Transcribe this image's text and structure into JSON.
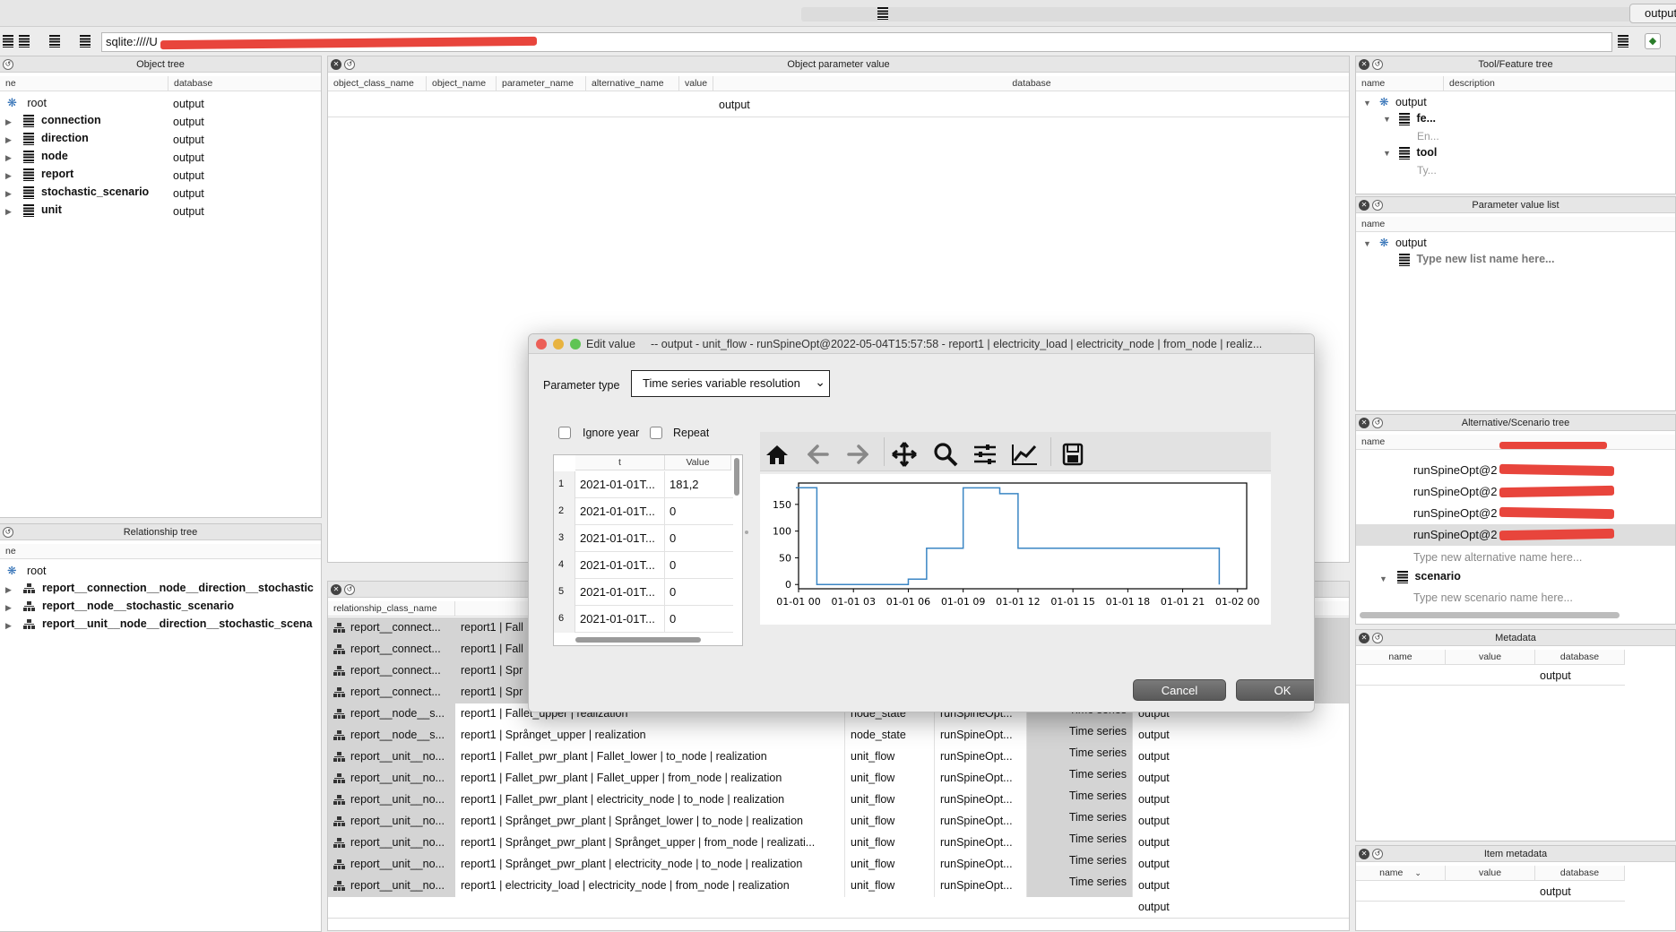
{
  "topbar": {
    "output_tab": "output",
    "url": "sqlite:////U"
  },
  "object_tree": {
    "title": "Object tree",
    "col_name": "ne",
    "col_db": "database",
    "root": {
      "label": "root",
      "db": "output"
    },
    "items": [
      {
        "label": "connection",
        "db": "output"
      },
      {
        "label": "direction",
        "db": "output"
      },
      {
        "label": "node",
        "db": "output"
      },
      {
        "label": "report",
        "db": "output"
      },
      {
        "label": "stochastic_scenario",
        "db": "output"
      },
      {
        "label": "unit",
        "db": "output"
      }
    ]
  },
  "relationship_tree": {
    "title": "Relationship tree",
    "col_name": "ne",
    "root": "root",
    "items": [
      "report__connection__node__direction__stochastic",
      "report__node__stochastic_scenario",
      "report__unit__node__direction__stochastic_scena"
    ]
  },
  "object_parameter_value": {
    "title": "Object parameter value",
    "headers": [
      "object_class_name",
      "object_name",
      "parameter_name",
      "alternative_name",
      "value",
      "database"
    ],
    "row_db": "output"
  },
  "relationship_parameter_value": {
    "header": "relationship_class_name",
    "rows": [
      {
        "cls": "report__connect...",
        "obj": "report1 | Fall",
        "param": "",
        "alt": "",
        "val": "",
        "db": ""
      },
      {
        "cls": "report__connect...",
        "obj": "report1 | Fall",
        "param": "",
        "alt": "",
        "val": "",
        "db": ""
      },
      {
        "cls": "report__connect...",
        "obj": "report1 | Spr",
        "param": "",
        "alt": "",
        "val": "",
        "db": ""
      },
      {
        "cls": "report__connect...",
        "obj": "report1 | Spr",
        "param": "",
        "alt": "",
        "val": "",
        "db": ""
      },
      {
        "cls": "report__node__s...",
        "obj": "report1 | Fallet_upper | realization",
        "param": "node_state",
        "alt": "runSpineOpt...",
        "val": "Time series",
        "db": "output"
      },
      {
        "cls": "report__node__s...",
        "obj": "report1 | Språnget_upper | realization",
        "param": "node_state",
        "alt": "runSpineOpt...",
        "val": "Time series",
        "db": "output"
      },
      {
        "cls": "report__unit__no...",
        "obj": "report1 | Fallet_pwr_plant | Fallet_lower | to_node | realization",
        "param": "unit_flow",
        "alt": "runSpineOpt...",
        "val": "Time series",
        "db": "output"
      },
      {
        "cls": "report__unit__no...",
        "obj": "report1 | Fallet_pwr_plant | Fallet_upper | from_node | realization",
        "param": "unit_flow",
        "alt": "runSpineOpt...",
        "val": "Time series",
        "db": "output"
      },
      {
        "cls": "report__unit__no...",
        "obj": "report1 | Fallet_pwr_plant | electricity_node | to_node | realization",
        "param": "unit_flow",
        "alt": "runSpineOpt...",
        "val": "Time series",
        "db": "output"
      },
      {
        "cls": "report__unit__no...",
        "obj": "report1 | Språnget_pwr_plant | Språnget_lower | to_node | realization",
        "param": "unit_flow",
        "alt": "runSpineOpt...",
        "val": "Time series",
        "db": "output"
      },
      {
        "cls": "report__unit__no...",
        "obj": "report1 | Språnget_pwr_plant | Språnget_upper | from_node | realizati...",
        "param": "unit_flow",
        "alt": "runSpineOpt...",
        "val": "Time series",
        "db": "output"
      },
      {
        "cls": "report__unit__no...",
        "obj": "report1 | Språnget_pwr_plant | electricity_node | to_node | realization",
        "param": "unit_flow",
        "alt": "runSpineOpt...",
        "val": "Time series",
        "db": "output"
      },
      {
        "cls": "report__unit__no...",
        "obj": "report1 | electricity_load | electricity_node | from_node | realization",
        "param": "unit_flow",
        "alt": "runSpineOpt...",
        "val": "Time series",
        "db": "output"
      }
    ],
    "empty_row_db": "output"
  },
  "tool_feature_tree": {
    "title": "Tool/Feature tree",
    "col_name": "name",
    "col_desc": "description",
    "root": "output",
    "features": "fe...",
    "features_hint": "En...",
    "tools": "tool",
    "tools_hint": "Ty..."
  },
  "parameter_value_list": {
    "title": "Parameter value list",
    "col_name": "name",
    "root": "output",
    "placeholder": "Type new list name here..."
  },
  "alt_scenario_tree": {
    "title": "Alternative/Scenario tree",
    "col_name": "name",
    "alternatives": [
      "runSpineOpt@2",
      "runSpineOpt@2",
      "runSpineOpt@2",
      "runSpineOpt@2"
    ],
    "alt_placeholder": "Type new alternative name here...",
    "scenario": "scenario",
    "scen_placeholder": "Type new scenario name here..."
  },
  "metadata": {
    "title": "Metadata",
    "headers": [
      "name",
      "value",
      "database"
    ],
    "row_db": "output"
  },
  "item_metadata": {
    "title": "Item metadata",
    "headers": [
      "name",
      "value",
      "database"
    ],
    "row_db": "output"
  },
  "dialog": {
    "title": "Edit value",
    "subtitle": "-- output - unit_flow - runSpineOpt@2022-05-04T15:57:58 - report1 | electricity_load | electricity_node | from_node | realiz...",
    "param_type_label": "Parameter type",
    "param_type_value": "Time series variable resolution",
    "ignore_year": "Ignore year",
    "repeat": "Repeat",
    "table_headers": [
      "t",
      "Value"
    ],
    "table_rows": [
      {
        "n": "1",
        "t": "2021-01-01T...",
        "v": "181,2"
      },
      {
        "n": "2",
        "t": "2021-01-01T...",
        "v": "0"
      },
      {
        "n": "3",
        "t": "2021-01-01T...",
        "v": "0"
      },
      {
        "n": "4",
        "t": "2021-01-01T...",
        "v": "0"
      },
      {
        "n": "5",
        "t": "2021-01-01T...",
        "v": "0"
      },
      {
        "n": "6",
        "t": "2021-01-01T...",
        "v": "0"
      }
    ],
    "cancel": "Cancel",
    "ok": "OK"
  },
  "chart_data": {
    "type": "line",
    "step": true,
    "title": "",
    "xlabel": "",
    "ylabel": "",
    "xlim": [
      0,
      24.5
    ],
    "ylim": [
      -8,
      190
    ],
    "x_tick_labels": [
      "01-01 00",
      "01-01 03",
      "01-01 06",
      "01-01 09",
      "01-01 12",
      "01-01 15",
      "01-01 18",
      "01-01 21",
      "01-02 00"
    ],
    "x_tick_hours": [
      0,
      3,
      6,
      9,
      12,
      15,
      18,
      21,
      24
    ],
    "y_ticks": [
      0,
      50,
      100,
      150
    ],
    "series": [
      {
        "x_hours": [
          0,
          1,
          6,
          7,
          9,
          11,
          12,
          23
        ],
        "y": [
          181.2,
          0,
          10,
          68,
          181,
          170,
          68,
          0
        ]
      }
    ],
    "color": "#3b86c4"
  }
}
